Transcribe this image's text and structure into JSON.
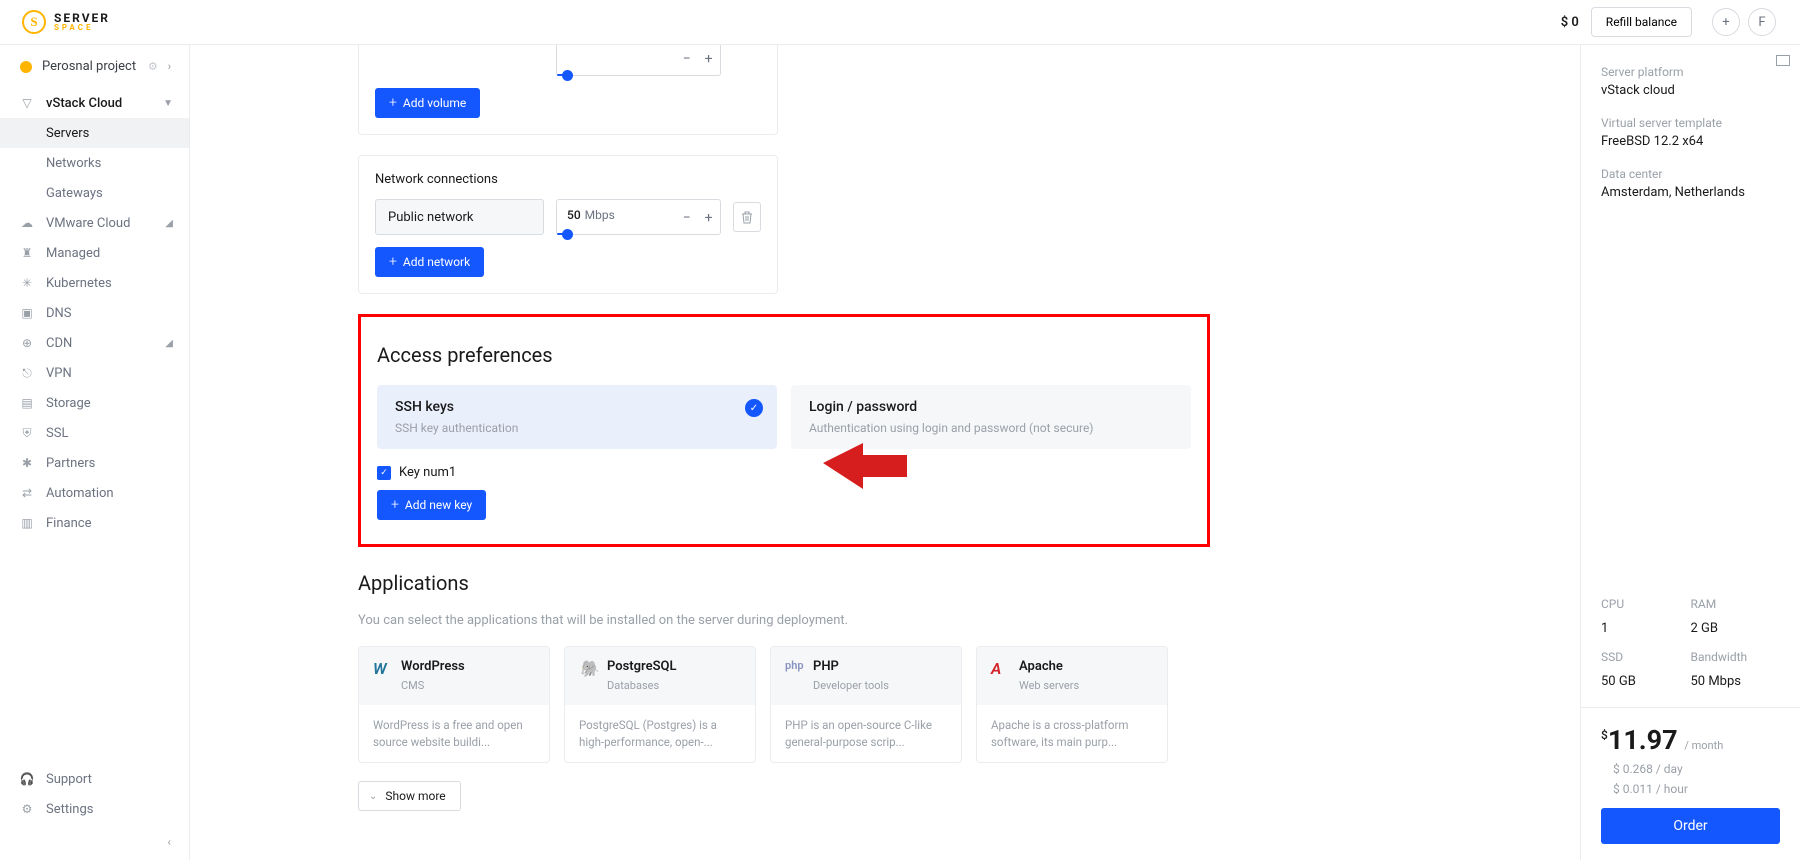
{
  "header": {
    "logo": {
      "top": "SERVER",
      "bottom": "SPACE"
    },
    "balance": "$ 0",
    "refill": "Refill balance",
    "plus": "+",
    "avatar": "F"
  },
  "sidebar": {
    "project": "Perosnal project",
    "vstack": {
      "label": "vStack Cloud",
      "children": [
        "Servers",
        "Networks",
        "Gateways"
      ]
    },
    "items": [
      {
        "label": "VMware Cloud",
        "icon": "cloud"
      },
      {
        "label": "Managed",
        "icon": "managed"
      },
      {
        "label": "Kubernetes",
        "icon": "kube"
      },
      {
        "label": "DNS",
        "icon": "dns"
      },
      {
        "label": "CDN",
        "icon": "cdn"
      },
      {
        "label": "VPN",
        "icon": "vpn"
      },
      {
        "label": "Storage",
        "icon": "storage"
      },
      {
        "label": "SSL",
        "icon": "ssl"
      },
      {
        "label": "Partners",
        "icon": "partners"
      },
      {
        "label": "Automation",
        "icon": "automation"
      },
      {
        "label": "Finance",
        "icon": "finance"
      }
    ],
    "footer": [
      {
        "label": "Support",
        "icon": "support"
      },
      {
        "label": "Settings",
        "icon": "settings"
      }
    ]
  },
  "main": {
    "volume": {
      "btn": "Add volume"
    },
    "network": {
      "title": "Network connections",
      "name": "Public network",
      "value": "50",
      "unit": "Mbps",
      "btn": "Add network"
    },
    "access": {
      "title": "Access preferences",
      "ssh": {
        "title": "SSH keys",
        "sub": "SSH key authentication"
      },
      "login": {
        "title": "Login / password",
        "sub": "Authentication using login and password (not secure)"
      },
      "key1": "Key num1",
      "addkey": "Add new key"
    },
    "apps": {
      "title": "Applications",
      "desc": "You can select the applications that will be installed on the server during deployment.",
      "list": [
        {
          "name": "WordPress",
          "cat": "CMS",
          "desc": "WordPress is a free and open source website buildi...",
          "ic": "W"
        },
        {
          "name": "PostgreSQL",
          "cat": "Databases",
          "desc": "PostgreSQL (Postgres) is a high-performance, open-...",
          "ic": "P"
        },
        {
          "name": "PHP",
          "cat": "Developer tools",
          "desc": "PHP is an open-source C-like general-purpose scrip...",
          "ic": "php"
        },
        {
          "name": "Apache",
          "cat": "Web servers",
          "desc": "Apache is a cross-platform software, its main purp...",
          "ic": "A"
        }
      ],
      "showmore": "Show more"
    }
  },
  "summary": {
    "platform_lbl": "Server platform",
    "platform": "vStack cloud",
    "template_lbl": "Virtual server template",
    "template": "FreeBSD 12.2 x64",
    "dc_lbl": "Data center",
    "dc": "Amsterdam, Netherlands",
    "specs": {
      "cpu_lbl": "CPU",
      "cpu": "1",
      "ram_lbl": "RAM",
      "ram": "2 GB",
      "ssd_lbl": "SSD",
      "ssd": "50 GB",
      "bw_lbl": "Bandwidth",
      "bw": "50 Mbps"
    },
    "price": "11.97",
    "price_unit": "/ month",
    "per_day": "$ 0.268 / day",
    "per_hour": "$ 0.011 / hour",
    "order": "Order"
  }
}
